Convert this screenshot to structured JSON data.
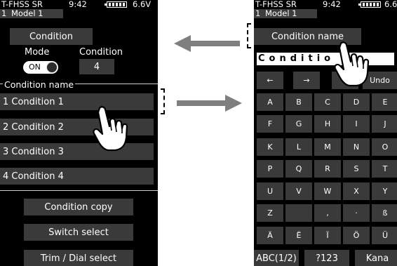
{
  "left_screen": {
    "status": {
      "mode": "T-FHSS SR",
      "time": "9:42",
      "voltage": "6.6V",
      "model_number": "1",
      "model_name": "Model 1"
    },
    "title_button": "Condition",
    "mode_label": "Mode",
    "condition_label": "Condition",
    "mode_toggle": "ON",
    "condition_value": "4",
    "group_label": "Condition name",
    "conditions": [
      "1 Condition 1",
      "2 Condition 2",
      "3 Condition 3",
      "4 Condition 4"
    ],
    "actions": [
      "Condition copy",
      "Switch select",
      "Trim / Dial select"
    ]
  },
  "right_screen": {
    "status": {
      "mode": "T-FHSS SR",
      "time": "9:42",
      "voltage": "6.6",
      "model_number": "1",
      "model_name": "Model 1"
    },
    "title_button": "Condition name",
    "text_value": "Conditio n",
    "keys": [
      [
        "←",
        "→",
        "",
        "Undo"
      ],
      [
        "A",
        "B",
        "C",
        "D",
        "E"
      ],
      [
        "F",
        "G",
        "H",
        "I",
        "J"
      ],
      [
        "K",
        "L",
        "M",
        "N",
        "O"
      ],
      [
        "P",
        "Q",
        "R",
        "S",
        "T"
      ],
      [
        "U",
        "V",
        "W",
        "X",
        "Y"
      ],
      [
        "Z",
        "",
        "‚",
        "·",
        "ß"
      ],
      [
        "Ä",
        "Ë",
        "Ï",
        "Ö",
        "Ü"
      ]
    ],
    "bottom_keys": [
      "ABC(1/2)",
      "?123",
      "Kana"
    ]
  },
  "annotations": {
    "arrow_color": "#7f7f7f",
    "hand_icon_left": "pointing-hand-icon",
    "hand_icon_right": "pointing-hand-icon"
  }
}
